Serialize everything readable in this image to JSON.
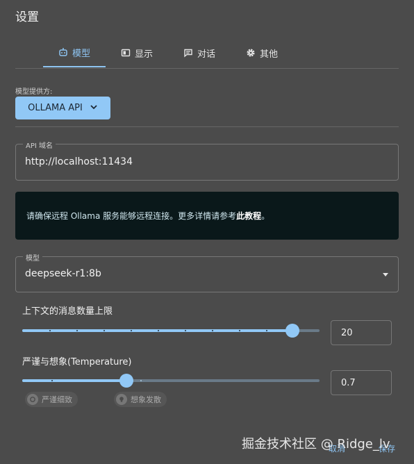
{
  "title": "设置",
  "tabs": [
    {
      "label": "模型",
      "icon": "robot-icon",
      "active": true
    },
    {
      "label": "显示",
      "icon": "display-icon",
      "active": false
    },
    {
      "label": "对话",
      "icon": "chat-icon",
      "active": false
    },
    {
      "label": "其他",
      "icon": "gear-icon",
      "active": false
    }
  ],
  "provider": {
    "label": "模型提供方:",
    "value": "OLLAMA API"
  },
  "api_domain": {
    "label": "API 域名",
    "value": "http://localhost:11434"
  },
  "info": {
    "text": "请确保远程 Ollama 服务能够远程连接。更多详情请参考",
    "link": "此教程",
    "suffix": "。"
  },
  "model": {
    "label": "模型",
    "value": "deepseek-r1:8b"
  },
  "context_limit": {
    "label": "上下文的消息数量上限",
    "value": "20",
    "level": 0.91
  },
  "temperature": {
    "label": "严谨与想象(Temperature)",
    "value": "0.7",
    "level": 0.35
  },
  "chips": {
    "strict": "严谨细致",
    "creative": "想象发散"
  },
  "watermark": "掘金技术社区 @ Ridge_lv",
  "footer": {
    "cancel": "取消",
    "save": "保存"
  },
  "colors": {
    "accent": "#91c8f6",
    "background": "#4b4b4b",
    "info_bg": "#0a181a"
  }
}
